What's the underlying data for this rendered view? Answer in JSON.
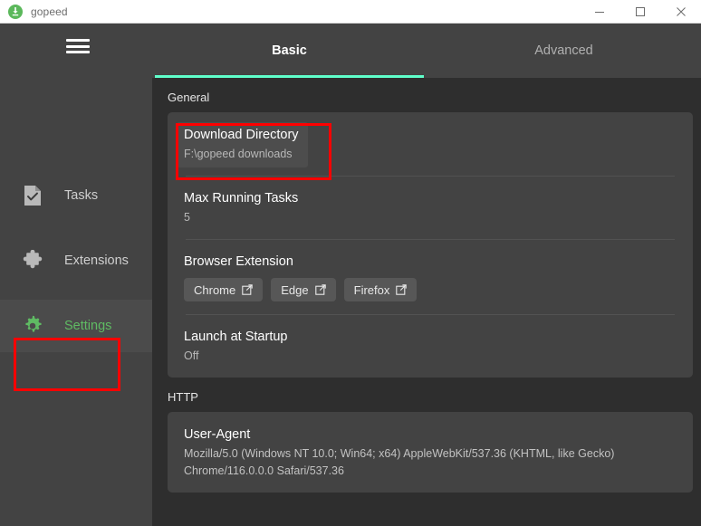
{
  "window": {
    "title": "gopeed",
    "logo_icon": "gopeed-download-logo",
    "controls": [
      {
        "name": "minimize",
        "icon": "minimize-icon"
      },
      {
        "name": "maximize",
        "icon": "maximize-icon"
      },
      {
        "name": "close",
        "icon": "close-icon"
      }
    ]
  },
  "sidebar": {
    "menu_icon": "hamburger-menu-icon",
    "items": [
      {
        "label": "Tasks",
        "icon": "task-document-check-icon",
        "active": false
      },
      {
        "label": "Extensions",
        "icon": "puzzle-piece-icon",
        "active": false
      },
      {
        "label": "Settings",
        "icon": "gear-icon",
        "active": true
      }
    ]
  },
  "tabs": [
    {
      "label": "Basic",
      "active": true
    },
    {
      "label": "Advanced",
      "active": false
    }
  ],
  "sections": {
    "general": {
      "heading": "General",
      "download_directory": {
        "title": "Download Directory",
        "value": "F:\\gopeed downloads"
      },
      "max_running_tasks": {
        "title": "Max Running Tasks",
        "value": "5"
      },
      "browser_extension": {
        "title": "Browser Extension",
        "buttons": [
          {
            "label": "Chrome",
            "icon": "external-link-icon"
          },
          {
            "label": "Edge",
            "icon": "external-link-icon"
          },
          {
            "label": "Firefox",
            "icon": "external-link-icon"
          }
        ]
      },
      "launch_at_startup": {
        "title": "Launch at Startup",
        "value": "Off"
      }
    },
    "http": {
      "heading": "HTTP",
      "user_agent": {
        "title": "User-Agent",
        "value": "Mozilla/5.0 (Windows NT 10.0; Win64; x64) AppleWebKit/537.36 (KHTML, like Gecko) Chrome/116.0.0.0 Safari/537.36"
      }
    }
  },
  "colors": {
    "accent_teal": "#5fffca",
    "accent_green": "#5fbb63",
    "annotation_red": "#ff0000",
    "card_bg": "#434343",
    "content_bg": "#2e2e2e"
  },
  "annotations": [
    {
      "name": "settings-nav-highlight"
    },
    {
      "name": "download-directory-highlight"
    }
  ]
}
